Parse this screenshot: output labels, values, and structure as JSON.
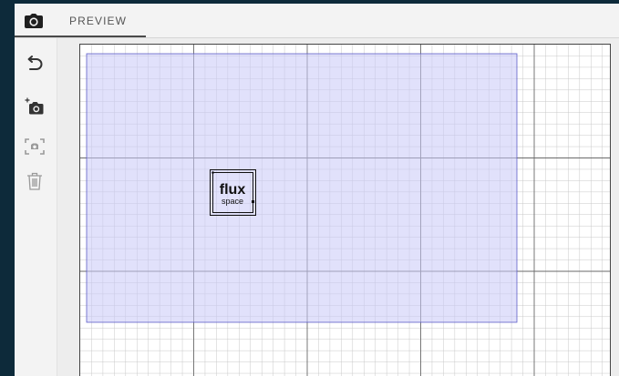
{
  "tabs": [
    {
      "label": "PREVIEW",
      "active": true
    }
  ],
  "toolbar": {
    "items": [
      {
        "name": "undo-icon",
        "enabled": true
      },
      {
        "name": "add-camera-icon",
        "enabled": true
      },
      {
        "name": "scan-area-icon",
        "enabled": false
      },
      {
        "name": "trash-icon",
        "enabled": false
      }
    ]
  },
  "workarea": {
    "preview_region_color": "#c8c8f8",
    "preview_region_border": "#5c5cc8",
    "logo_text": {
      "line1": "flux",
      "line2": "space"
    }
  },
  "colors": {
    "background": "#0d2a3a",
    "panel": "#f3f3f3",
    "grid_minor": "#c9c9c9",
    "grid_major": "#6a6a6a"
  }
}
